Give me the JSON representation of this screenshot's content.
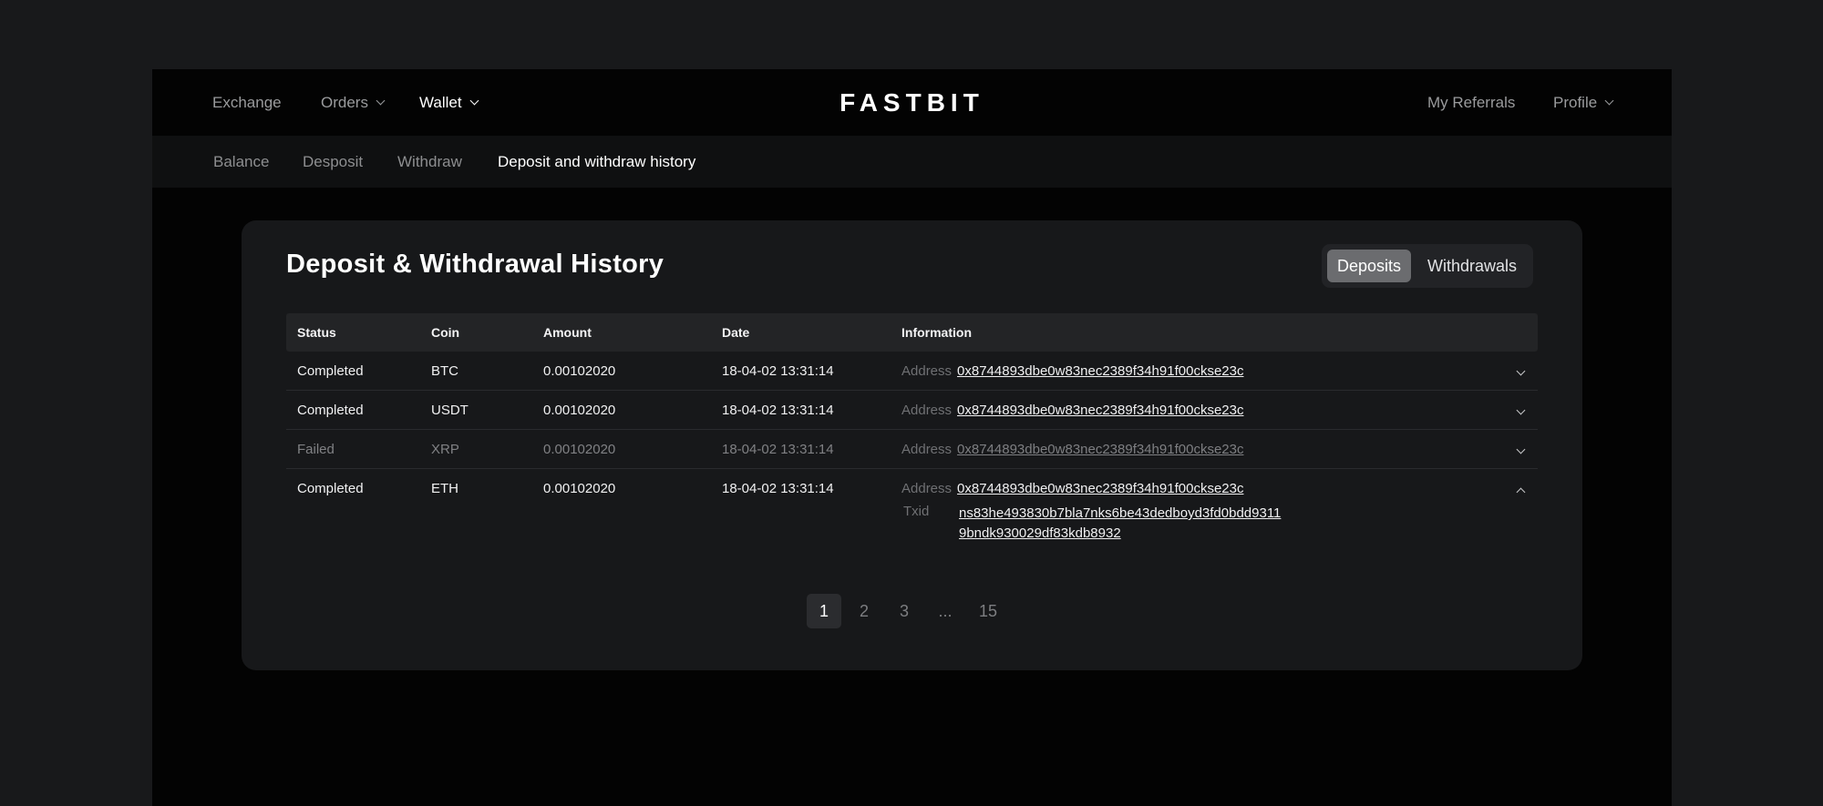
{
  "topnav": {
    "exchange": "Exchange",
    "orders": "Orders",
    "wallet": "Wallet",
    "logo": "FASTBIT",
    "referrals": "My Referrals",
    "profile": "Profile"
  },
  "subnav": {
    "balance": "Balance",
    "deposit": "Desposit",
    "withdraw": "Withdraw",
    "history": "Deposit and withdraw history"
  },
  "card": {
    "title": "Deposit & Withdrawal History",
    "toggle": {
      "deposits": "Deposits",
      "withdrawals": "Withdrawals",
      "selected": "Deposits"
    }
  },
  "table": {
    "headers": {
      "status": "Status",
      "coin": "Coin",
      "amount": "Amount",
      "date": "Date",
      "info": "Information"
    },
    "address_label": "Address",
    "txid_label": "Txid",
    "rows": [
      {
        "status": "Completed",
        "coin": "BTC",
        "amount": "0.00102020",
        "date": "18-04-02 13:31:14",
        "address": "0x8744893dbe0w83nec2389f34h91f00ckse23c"
      },
      {
        "status": "Completed",
        "coin": "USDT",
        "amount": "0.00102020",
        "date": "18-04-02 13:31:14",
        "address": "0x8744893dbe0w83nec2389f34h91f00ckse23c"
      },
      {
        "status": "Failed",
        "coin": "XRP",
        "amount": "0.00102020",
        "date": "18-04-02 13:31:14",
        "address": "0x8744893dbe0w83nec2389f34h91f00ckse23c"
      },
      {
        "status": "Completed",
        "coin": "ETH",
        "amount": "0.00102020",
        "date": "18-04-02 13:31:14",
        "address": "0x8744893dbe0w83nec2389f34h91f00ckse23c",
        "txid_line1": "ns83he493830b7bla7nks6be43dedboyd3fd0bdd9311",
        "txid_line2": "9bndk930029df83kdb8932"
      }
    ]
  },
  "pagination": {
    "pages": [
      "1",
      "2",
      "3",
      "...",
      "15"
    ],
    "current": "1"
  }
}
